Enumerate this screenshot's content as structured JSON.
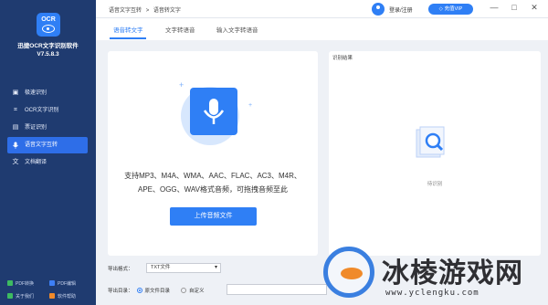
{
  "app": {
    "logo_text": "OCR",
    "name": "迅捷OCR文字识别软件",
    "version": "V7.5.8.3"
  },
  "sidebar": {
    "items": [
      {
        "label": "极速识别",
        "icon": "image-icon"
      },
      {
        "label": "OCR文字识别",
        "icon": "scan-icon"
      },
      {
        "label": "票证识别",
        "icon": "ticket-icon"
      },
      {
        "label": "语音文字互转",
        "icon": "microphone-icon"
      },
      {
        "label": "文档翻译",
        "icon": "translate-icon"
      }
    ],
    "active_index": 3,
    "bottom_links": [
      {
        "label": "PDF转换",
        "color": "#3dbb61"
      },
      {
        "label": "PDF编辑",
        "color": "#3d7ff5"
      },
      {
        "label": "关于我们",
        "color": "#3dbb61"
      },
      {
        "label": "软件帮助",
        "color": "#f08a2a"
      }
    ]
  },
  "topbar": {
    "breadcrumb": [
      "语音文字互转",
      ">",
      "语音转文字"
    ],
    "login_label": "登录/注册",
    "vip_label": "充值VIP",
    "window_controls": [
      "—",
      "□",
      "✕"
    ]
  },
  "tabs": [
    {
      "label": "语音转文字",
      "active": true
    },
    {
      "label": "文字转语音",
      "active": false
    },
    {
      "label": "输入文字转语音",
      "active": false
    }
  ],
  "upload": {
    "formats_line1": "支持MP3、M4A、WMA、AAC、FLAC、AC3、M4R、",
    "formats_line2": "APE、OGG、WAV格式音频，可拖拽音频至此",
    "button_label": "上传音频文件"
  },
  "result": {
    "title": "识别结果",
    "hint": "待识别"
  },
  "settings": {
    "export_format_label": "导出格式：",
    "export_format_value": "TXT文件",
    "export_dir_label": "导出目录：",
    "dir_option_source": "原文件目录",
    "dir_option_custom": "自定义"
  },
  "watermark": {
    "text": "冰棱游戏网",
    "url": "www.yclengku.com"
  },
  "colors": {
    "accent": "#2f7ff5",
    "sidebar_bg": "#1f3b70"
  }
}
